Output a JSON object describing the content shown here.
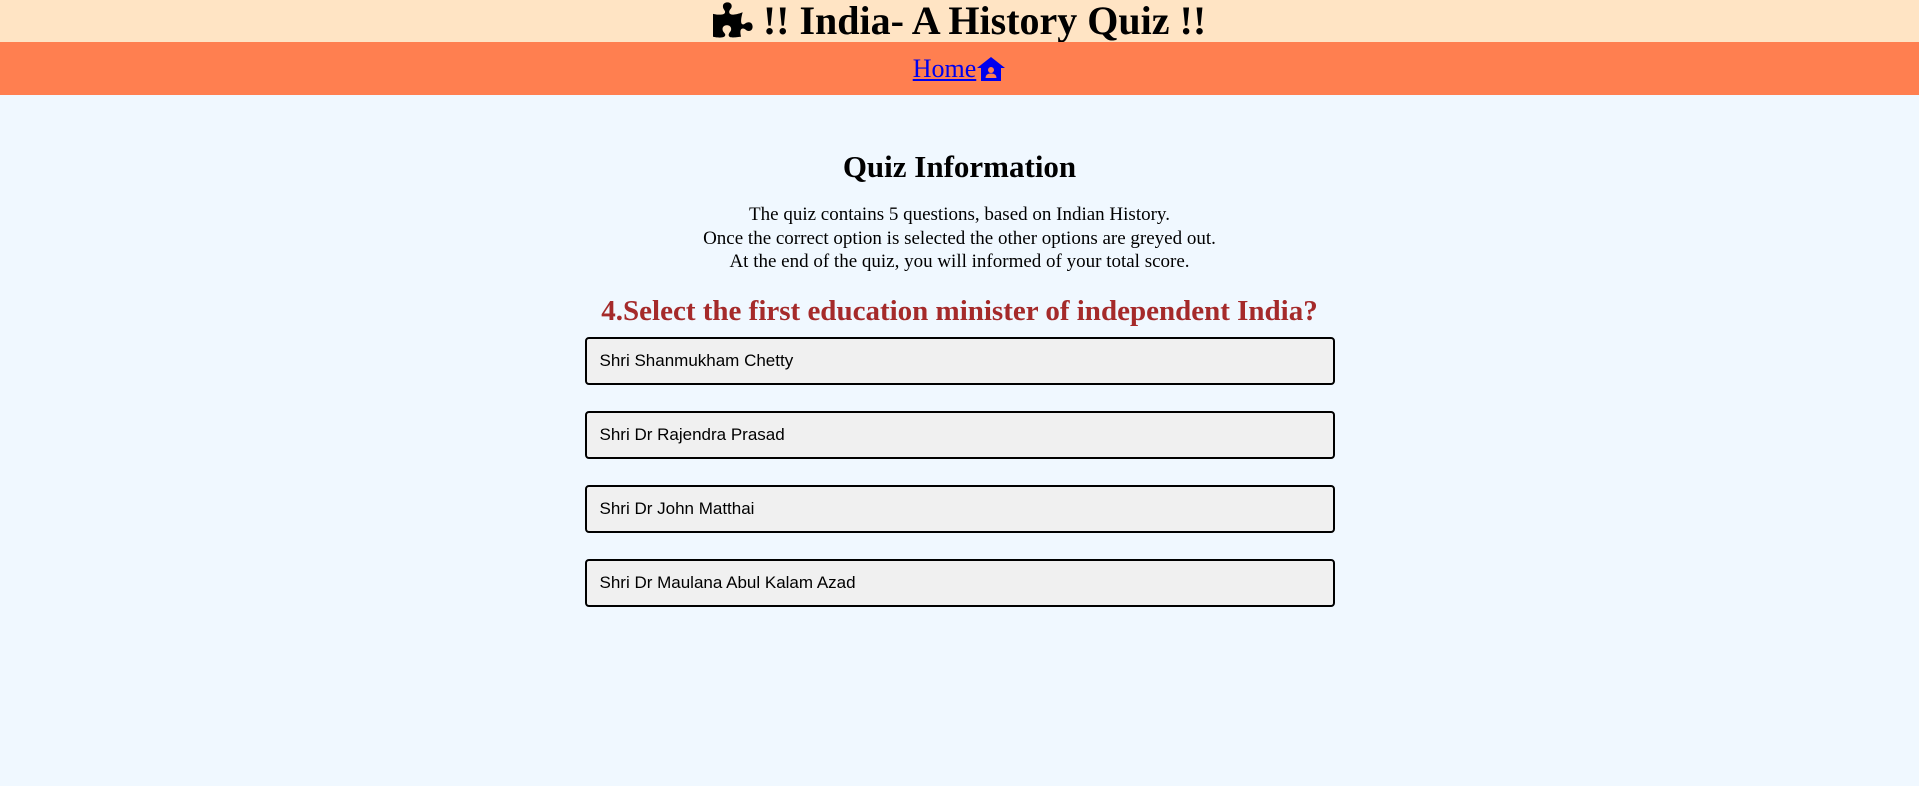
{
  "header": {
    "title": "!! India- A History Quiz !!",
    "icon": "puzzle-icon"
  },
  "nav": {
    "home_label": "Home",
    "home_icon": "home-icon",
    "link_color": "#0000ee"
  },
  "info": {
    "title": "Quiz Information",
    "lines": [
      "The quiz contains 5 questions, based on Indian History.",
      "Once the correct option is selected the other options are greyed out.",
      "At the end of the quiz, you will informed of your total score."
    ]
  },
  "question": {
    "text": "4.Select the first education minister of independent India?",
    "color": "#a52a2a"
  },
  "options": [
    "Shri Shanmukham Chetty",
    "Shri Dr Rajendra Prasad",
    "Shri Dr John Matthai",
    "Shri Dr Maulana Abul Kalam Azad"
  ],
  "colors": {
    "header_bg": "#ffe4c4",
    "nav_bg": "#ff7f50",
    "page_bg": "#f0f8ff"
  }
}
